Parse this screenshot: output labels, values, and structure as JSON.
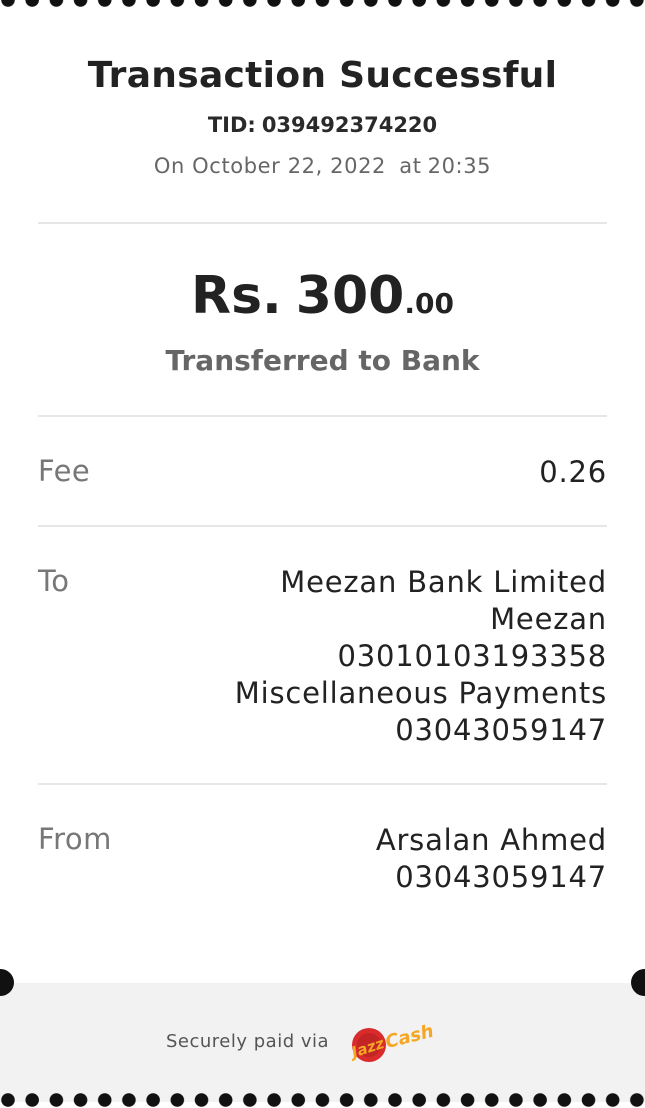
{
  "receipt": {
    "title": "Transaction Successful",
    "tid_label": "TID:",
    "tid_value": "039492374220",
    "date_prefix": "On",
    "date": "October 22, 2022",
    "date_at": "at",
    "time": "20:35"
  },
  "amount": {
    "currency": "Rs.",
    "whole": "300",
    "decimal": ".00",
    "description": "Transferred to Bank"
  },
  "fee": {
    "label": "Fee",
    "value": "0.26"
  },
  "to": {
    "label": "To",
    "lines": [
      "Meezan Bank Limited",
      "Meezan",
      "03010103193358",
      "Miscellaneous Payments",
      "03043059147"
    ]
  },
  "from": {
    "label": "From",
    "lines": [
      "Arsalan Ahmed",
      "03043059147"
    ]
  },
  "footer": {
    "secure_text": "Securely paid via",
    "logo_text_1": "Jazz",
    "logo_text_2": "Cash"
  },
  "colors": {
    "logo_red": "#d92b2b",
    "logo_orange": "#f5a623",
    "accent_dark": "#222222"
  }
}
